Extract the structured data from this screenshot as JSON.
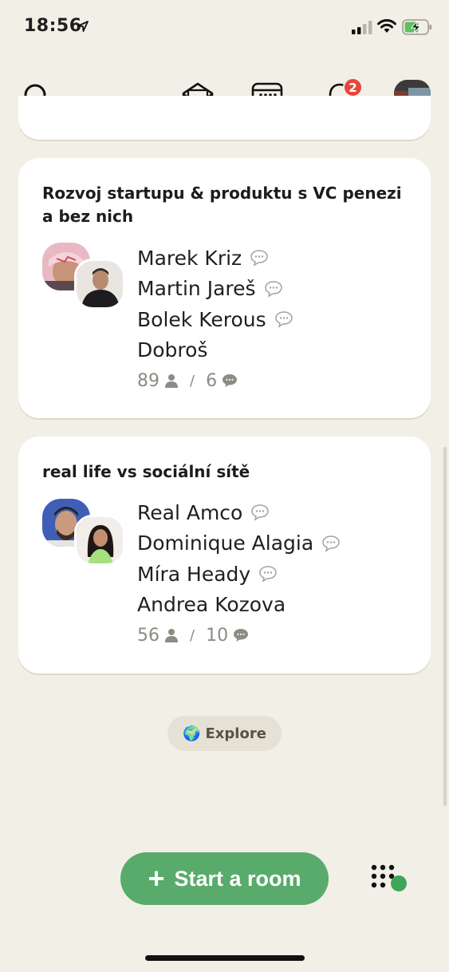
{
  "status_bar": {
    "time": "18:56"
  },
  "nav": {
    "notifications_count": "2"
  },
  "rooms": [
    {
      "title": "Rozvoj startupu & produktu s VC penezi a bez nich",
      "speakers": [
        {
          "name": "Marek Kriz",
          "speaking_icon": true
        },
        {
          "name": "Martin Jareš",
          "speaking_icon": true
        },
        {
          "name": "Bolek Kerous",
          "speaking_icon": true
        },
        {
          "name": "Dobroš",
          "speaking_icon": false
        }
      ],
      "listeners": "89",
      "speakers_count": "6"
    },
    {
      "title": "real life vs sociální sítě",
      "speakers": [
        {
          "name": "Real Amco",
          "speaking_icon": true
        },
        {
          "name": "Dominique Alagia",
          "speaking_icon": true
        },
        {
          "name": "Míra Heady",
          "speaking_icon": true
        },
        {
          "name": "Andrea Kozova",
          "speaking_icon": false
        }
      ],
      "listeners": "56",
      "speakers_count": "10"
    }
  ],
  "explore": {
    "label": "Explore",
    "emoji": "🌍"
  },
  "start_room": {
    "label": "Start a room",
    "plus": "+"
  },
  "colors": {
    "background": "#f1efe6",
    "accent_green": "#58ab6b",
    "badge_red": "#e4473b",
    "muted_text": "#8e8b84"
  }
}
